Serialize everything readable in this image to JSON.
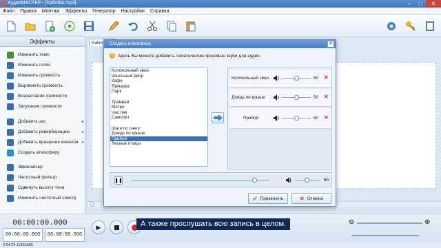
{
  "window": {
    "title": "АудиоМАСТЕР - [Kalimba.mp3]"
  },
  "menu": [
    "Файл",
    "Правка",
    "Монтаж",
    "Эффекты",
    "Генератор",
    "Настройки",
    "Справка"
  ],
  "sidebar": {
    "header": "Эффекты",
    "items": [
      {
        "label": "Изменить темп",
        "icon": "tempo-icon",
        "color": "#4d8f3a"
      },
      {
        "label": "Изменить голос",
        "icon": "voice-icon",
        "color": "#3a6ea8"
      },
      {
        "label": "Изменить громкость",
        "icon": "volume-icon",
        "color": "#3a6ea8"
      },
      {
        "label": "Выровнять громкость",
        "icon": "normalize-icon",
        "color": "#3a6ea8"
      },
      {
        "label": "Возрастание громкости",
        "icon": "fade-in-icon",
        "color": "#3a6ea8"
      },
      {
        "label": "Затухание громкости",
        "icon": "fade-out-icon",
        "color": "#3a6ea8"
      },
      {
        "label": "Добавить эхо",
        "icon": "echo-icon",
        "color": "#3a6ea8"
      },
      {
        "label": "Добавить реверберацию",
        "icon": "reverb-icon",
        "color": "#3a6ea8"
      },
      {
        "label": "Добавить вращение каналов",
        "icon": "rotate-channels-icon",
        "color": "#3a6ea8"
      },
      {
        "label": "Создать атмосферу",
        "icon": "atmosphere-icon",
        "color": "#2e8fd0"
      },
      {
        "label": "Эквалайзер",
        "icon": "equalizer-icon",
        "color": "#3a6ea8"
      },
      {
        "label": "Частотный фильтр",
        "icon": "filter-icon",
        "color": "#3a6ea8"
      },
      {
        "label": "Сдвинуть высоту тона",
        "icon": "pitch-icon",
        "color": "#3a6ea8"
      },
      {
        "label": "Изменить частотный спектр",
        "icon": "spectrum-icon",
        "color": "#3a6ea8"
      }
    ]
  },
  "workspace": {
    "file_tab": "Kalim"
  },
  "dialog": {
    "title": "Создать атмосферу",
    "info": "Здесь Вы можете добавить тематические фоновые звуки для аудио.",
    "list": [
      "Колокольный звон",
      "Школьный двор",
      "Кафе",
      "Ярмарка",
      "Парк",
      "",
      "Трамвай",
      "Метро",
      "Час пик",
      "Самолёт",
      "",
      "Шаги по снегу",
      "Дождь по крыше",
      "Прибой",
      "Лесные птицы"
    ],
    "selected_index": 13,
    "sounds": [
      {
        "name": "Колокольный звон",
        "volume": "50"
      },
      {
        "name": "Дождь по крыше",
        "volume": "50"
      },
      {
        "name": "Прибой",
        "volume": "50"
      }
    ],
    "preview": {
      "master_volume": "50"
    },
    "apply_label": "Применить",
    "cancel_label": "Отмена"
  },
  "transport": {
    "position": "00:00:00.000",
    "selection_start": "00:00:00.000",
    "selection_end": "00:00:00.000"
  },
  "subtitle": "А также прослушать всю запись в целом.",
  "status": "0:04:29 11855085",
  "colors": {
    "accent": "#3f76bd",
    "delete": "#d0302a",
    "selection": "#3f6fb3"
  }
}
